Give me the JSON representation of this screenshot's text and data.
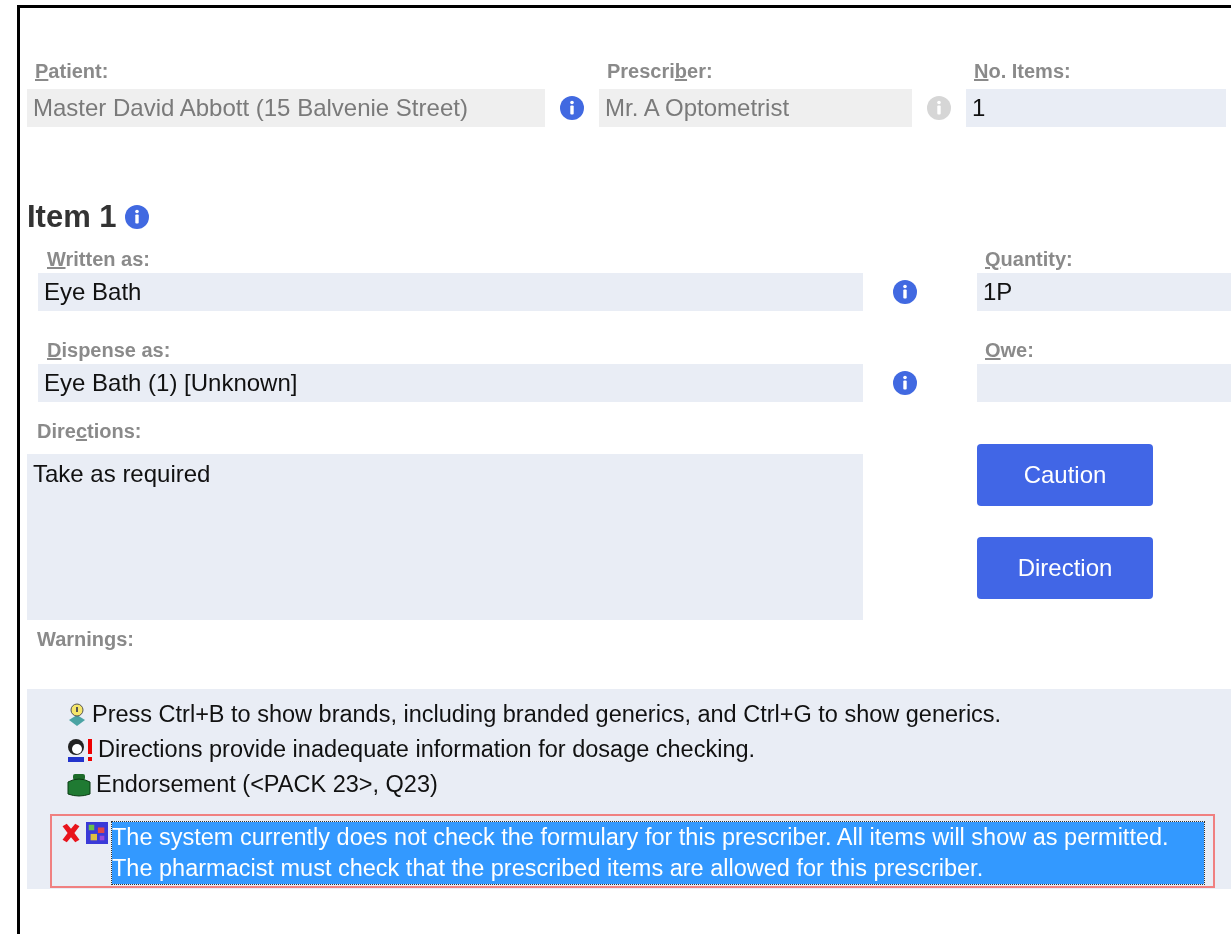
{
  "header_fields": [
    {
      "label": {
        "key": "P",
        "after": "atient:"
      },
      "value": "Master David Abbott (15 Balvenie Street)",
      "disabled": true,
      "info": {
        "disabled": false
      }
    },
    {
      "label": {
        "before": "Prescri",
        "key": "b",
        "after": "er:"
      },
      "value": "Mr. A Optometrist",
      "disabled": true,
      "info": {
        "disabled": true
      }
    },
    {
      "label": {
        "key": "N",
        "after": "o. Items:"
      },
      "value": "1",
      "disabled": false
    }
  ],
  "item": {
    "title": "Item 1",
    "written_as": {
      "label": {
        "key": "W",
        "after": "ritten as:"
      },
      "value": "Eye Bath"
    },
    "quantity": {
      "label": {
        "key": "Q",
        "after": "uantity:"
      },
      "value": "1P"
    },
    "dispense_as": {
      "label": {
        "key": "D",
        "after": "ispense as:"
      },
      "value": "Eye Bath (1) [Unknown]"
    },
    "owe": {
      "label": {
        "key": "O",
        "after": "we:"
      }
    },
    "directions": {
      "label": {
        "before": "Dire",
        "key": "c",
        "after": "tions:"
      },
      "value": "Take as required"
    },
    "buttons": [
      "Caution",
      "Direction"
    ]
  },
  "warnings": {
    "label": "Warnings:",
    "items": [
      {
        "kind": "hint",
        "text": "Press Ctrl+B to show brands, including branded generics, and Ctrl+G to show generics.",
        "selected": false
      },
      {
        "kind": "dosage",
        "text": "Directions provide inadequate information for dosage checking.",
        "selected": false
      },
      {
        "kind": "endorsement",
        "text": "Endorsement (<PACK 23>, Q23)",
        "selected": false
      },
      {
        "kind": "formulary",
        "text": "The system currently does not check the formulary for this prescriber. All items will show as permitted. The pharmacist must check that the prescribed items are allowed for this prescriber.",
        "selected": true
      }
    ]
  }
}
